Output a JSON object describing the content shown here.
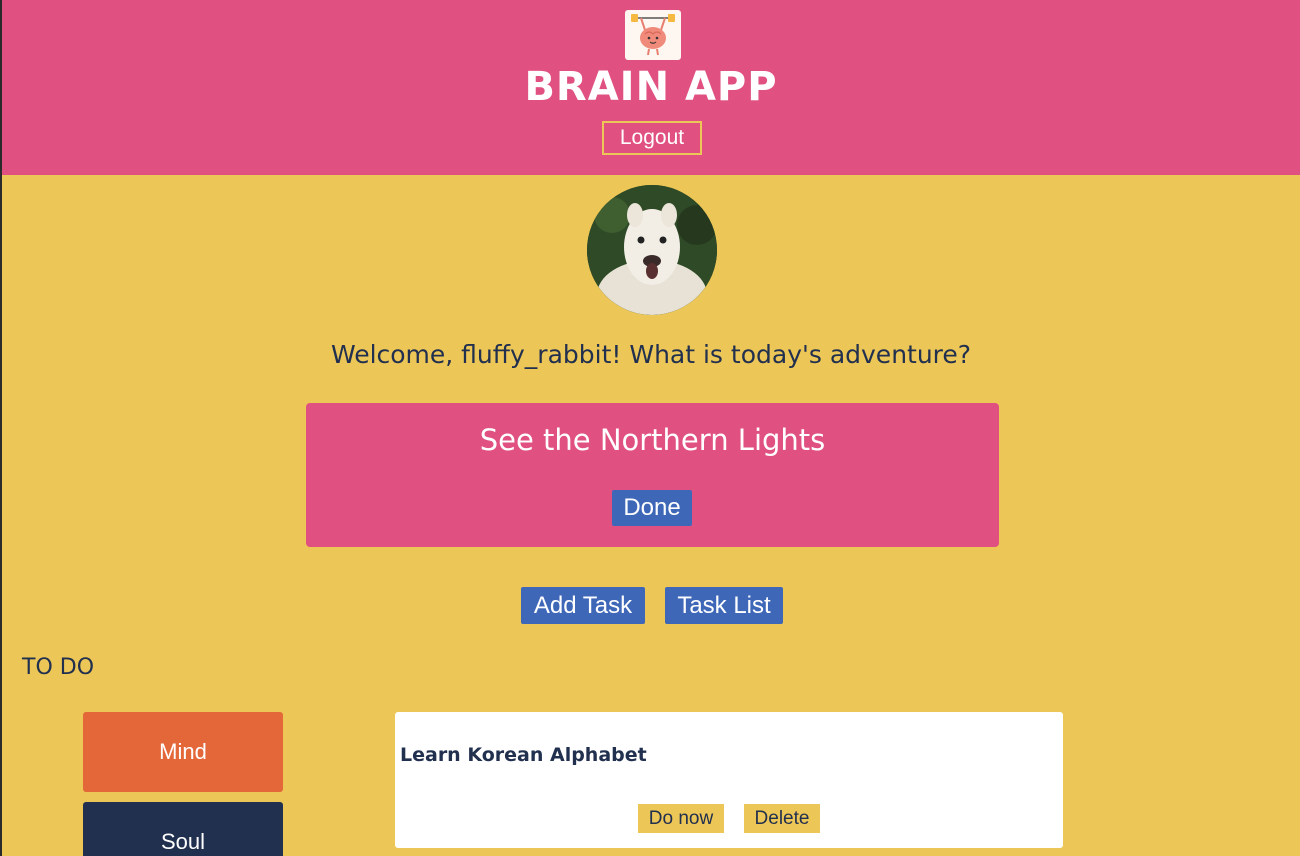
{
  "header": {
    "app_title": "BRAIN APP",
    "logout_label": "Logout",
    "logo_icon": "brain-lifting-weights-icon"
  },
  "profile": {
    "avatar": "alpaca-avatar",
    "welcome_text": "Welcome, fluffy_rabbit! What is today's adventure?"
  },
  "adventure": {
    "title": "See the Northern Lights",
    "done_label": "Done"
  },
  "actions": {
    "add_task_label": "Add Task",
    "task_list_label": "Task List"
  },
  "todo": {
    "heading": "TO DO",
    "categories": [
      {
        "label": "Mind",
        "color": "#e4673a"
      },
      {
        "label": "Soul",
        "color": "#22304f"
      }
    ],
    "tasks": [
      {
        "name": "Learn Korean Alphabet",
        "do_now_label": "Do now",
        "delete_label": "Delete"
      }
    ]
  },
  "colors": {
    "header_bg": "#e05181",
    "page_bg": "#ecc656",
    "button_blue": "#3f67b8",
    "text_dark": "#22304f"
  }
}
